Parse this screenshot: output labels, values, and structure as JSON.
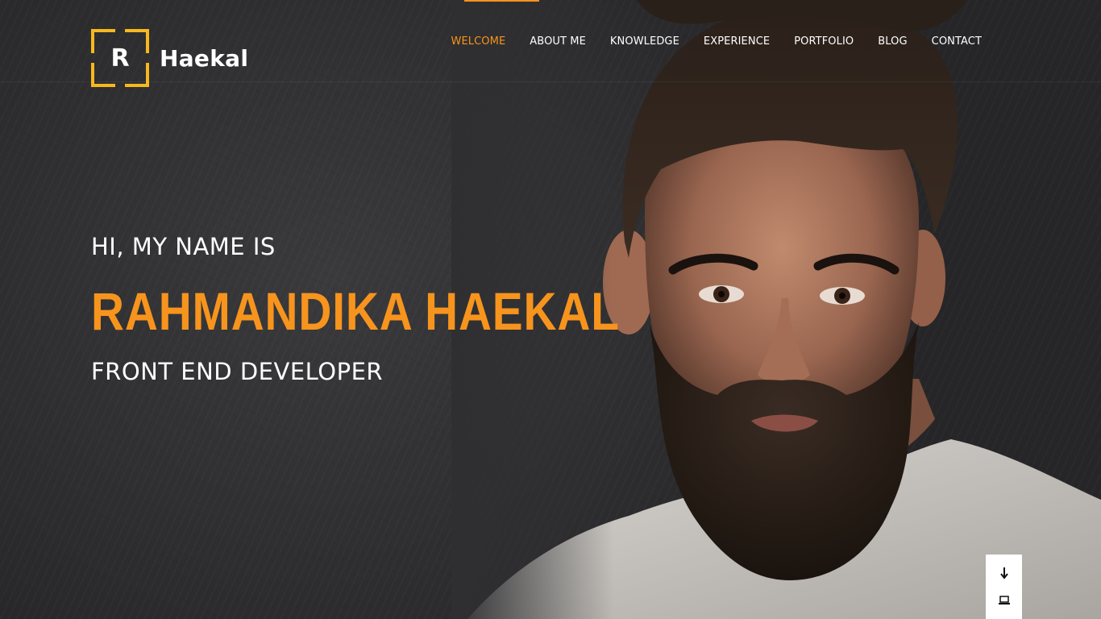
{
  "brand": {
    "logo_letter": "R",
    "name": "Haekal",
    "accent_color": "#f7b81d"
  },
  "nav": {
    "items": [
      {
        "label": "WELCOME",
        "active": true
      },
      {
        "label": "ABOUT ME",
        "active": false
      },
      {
        "label": "KNOWLEDGE",
        "active": false
      },
      {
        "label": "EXPERIENCE",
        "active": false
      },
      {
        "label": "PORTFOLIO",
        "active": false
      },
      {
        "label": "BLOG",
        "active": false
      },
      {
        "label": "CONTACT",
        "active": false
      }
    ],
    "active_color": "#f7941d"
  },
  "hero": {
    "intro": "HI, MY NAME IS",
    "name": "RAHMANDIKA HAEKAL",
    "role": "FRONT END DEVELOPER",
    "name_color": "#f7941d",
    "background_color": "#2f2f31"
  },
  "side_widget": {
    "buttons": [
      {
        "icon": "arrow-down-icon",
        "glyph": "➘"
      },
      {
        "icon": "laptop-icon",
        "glyph": "💻"
      }
    ]
  }
}
